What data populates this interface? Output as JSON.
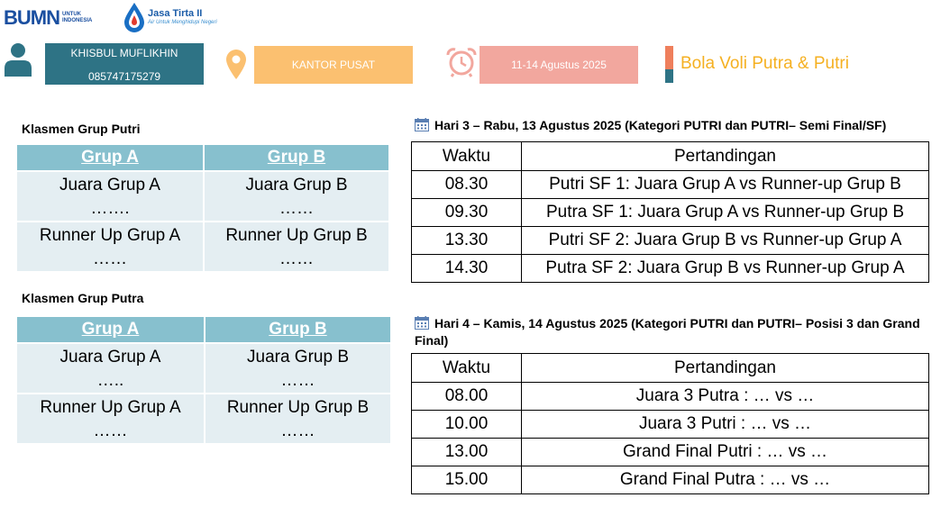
{
  "logos": {
    "bumn_word": "BUMN",
    "bumn_sub_1": "UNTUK",
    "bumn_sub_2": "INDONESIA",
    "jt_title": "Jasa Tirta II",
    "jt_tagline": "Air Untuk Menghidupi Negeri"
  },
  "header": {
    "name": "KHISBUL MUFLIKHIN",
    "phone": "085747175279",
    "office": "KANTOR PUSAT",
    "dates": "11-14 Agustus 2025",
    "sport": "Bola Voli Putra & Putri"
  },
  "colors": {
    "teal": "#2e7385",
    "orange": "#fbc070",
    "salmon": "#f2a79e",
    "coral": "#ef7f5c",
    "gold": "#f5b021",
    "table_header": "#87c0ce",
    "table_cell": "#e4eef2"
  },
  "icons": [
    "person-icon",
    "location-pin-icon",
    "alarm-clock-icon",
    "calendar-icon"
  ],
  "standings": [
    {
      "title": "Klasmen Grup Putri",
      "headers": [
        "Grup A",
        "Grup B"
      ],
      "rows": [
        [
          "Juara Grup A",
          "Juara Grup B"
        ],
        [
          "…….",
          "……"
        ],
        [
          "Runner Up Grup A",
          "Runner Up Grup B"
        ],
        [
          "……",
          "……"
        ]
      ]
    },
    {
      "title": "Klasmen Grup Putra",
      "headers": [
        "Grup A",
        "Grup B"
      ],
      "rows": [
        [
          "Juara Grup A",
          "Juara Grup B"
        ],
        [
          "…..",
          "……"
        ],
        [
          "Runner Up Grup A",
          "Runner Up Grup B"
        ],
        [
          "……",
          "……"
        ]
      ]
    }
  ],
  "schedule": [
    {
      "title": "Hari 3 – Rabu, 13 Agustus 2025 (Kategori PUTRI  dan PUTRI– Semi Final/SF)",
      "headers": [
        "Waktu",
        "Pertandingan"
      ],
      "rows": [
        [
          "08.30",
          "Putri SF 1: Juara Grup A vs Runner-up Grup B"
        ],
        [
          "09.30",
          "Putra SF 1: Juara Grup A vs Runner-up Grup B"
        ],
        [
          "13.30",
          "Putri SF 2: Juara Grup B vs Runner-up Grup A"
        ],
        [
          "14.30",
          "Putra SF 2: Juara Grup B vs Runner-up Grup A"
        ]
      ]
    },
    {
      "title": "Hari 4 – Kamis, 14 Agustus 2025 (Kategori PUTRI  dan PUTRI– Posisi 3 dan Grand Final)",
      "headers": [
        "Waktu",
        "Pertandingan"
      ],
      "rows": [
        [
          "08.00",
          "Juara 3 Putra : … vs …"
        ],
        [
          "10.00",
          "Juara 3 Putri : … vs …"
        ],
        [
          "13.00",
          "Grand Final Putri : … vs …"
        ],
        [
          "15.00",
          "Grand Final Putra : … vs …"
        ]
      ]
    }
  ]
}
